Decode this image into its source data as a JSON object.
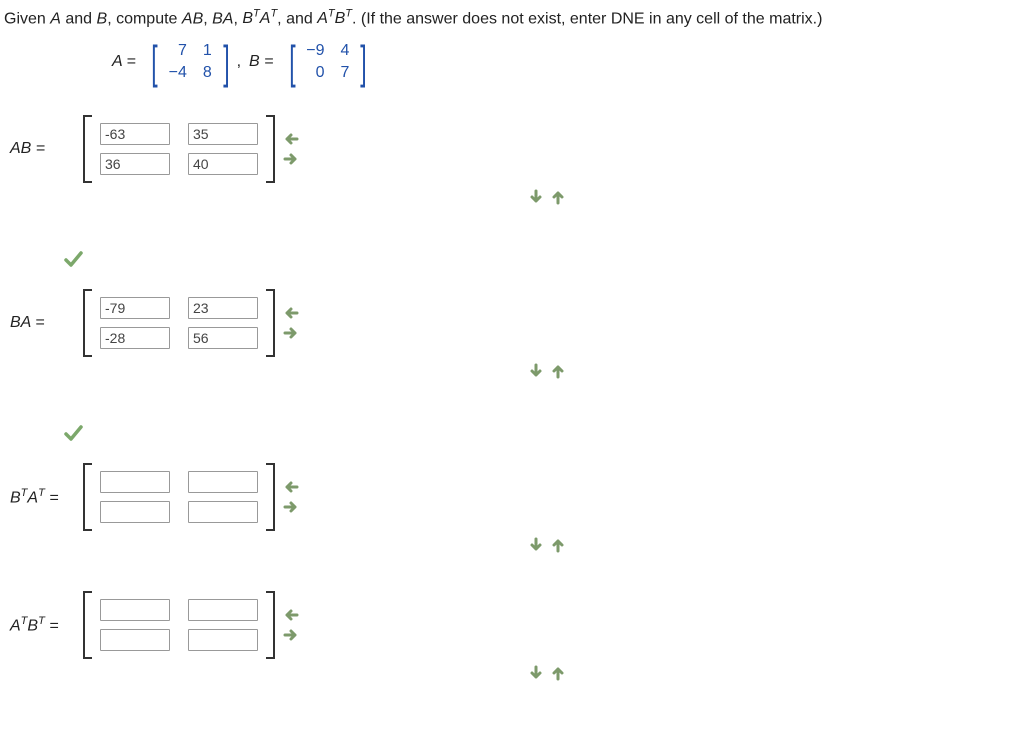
{
  "question": {
    "intro": "Given ",
    "A": "A",
    "and": " and ",
    "B": "B",
    "compute": ", compute ",
    "AB": "AB",
    "sep1": ", ",
    "BA": "BA",
    "sep2": ", ",
    "BTAT_pre": "B",
    "BTAT_sup1": "T",
    "BTAT_mid": "A",
    "BTAT_sup2": "T",
    "sep3": ", and ",
    "ATBT_pre": "A",
    "ATBT_sup1": "T",
    "ATBT_mid": "B",
    "ATBT_sup2": "T",
    "outro": ". (If the answer does not exist, enter DNE in any cell of the matrix.)"
  },
  "matrixA": {
    "label": "A =",
    "r0c0": "7",
    "r0c1": "1",
    "r1c0": "−4",
    "r1c1": "8"
  },
  "comma": ", ",
  "matrixB": {
    "label": "B =",
    "r0c0": "−9",
    "r0c1": "4",
    "r1c0": "0",
    "r1c1": "7"
  },
  "rows": {
    "AB": {
      "labelLeft": "AB",
      "labelEq": "  =",
      "values": {
        "c00": "-63",
        "c01": "35",
        "c10": "36",
        "c11": "40"
      },
      "correct": true
    },
    "BA": {
      "labelLeft": "BA",
      "labelEq": "  =",
      "values": {
        "c00": "-79",
        "c01": "23",
        "c10": "-28",
        "c11": "56"
      },
      "correct": true
    },
    "BTAT": {
      "labelB": "B",
      "supT1": "T",
      "labelA": "A",
      "supT2": "T",
      "labelEq": "  =",
      "values": {
        "c00": "",
        "c01": "",
        "c10": "",
        "c11": ""
      }
    },
    "ATBT": {
      "labelA": "A",
      "supT1": "T",
      "labelB": "B",
      "supT2": "T",
      "labelEq": "  =",
      "values": {
        "c00": "",
        "c01": "",
        "c10": "",
        "c11": ""
      }
    }
  }
}
